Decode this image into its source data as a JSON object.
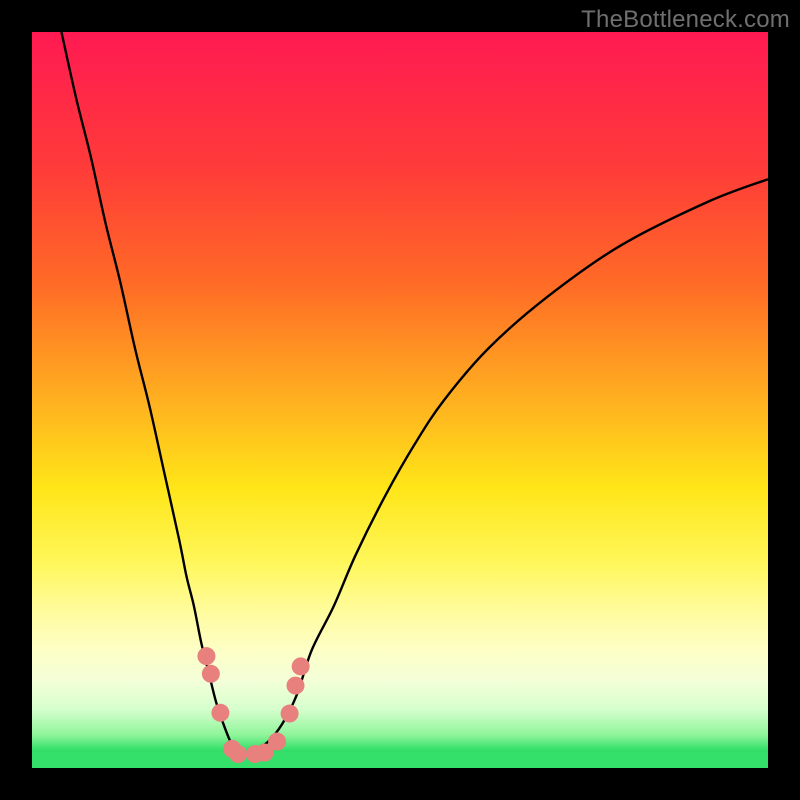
{
  "watermark": "TheBottleneck.com",
  "colors": {
    "curve_stroke": "#000000",
    "marker_fill": "#e8817e",
    "green_band": "#35e06a",
    "gradient_stops": [
      {
        "offset": 0.0,
        "color": "#ff1a52"
      },
      {
        "offset": 0.18,
        "color": "#ff3a3a"
      },
      {
        "offset": 0.34,
        "color": "#ff6a26"
      },
      {
        "offset": 0.5,
        "color": "#ffb020"
      },
      {
        "offset": 0.62,
        "color": "#ffe618"
      },
      {
        "offset": 0.72,
        "color": "#fff75a"
      },
      {
        "offset": 0.79,
        "color": "#fffca0"
      },
      {
        "offset": 0.84,
        "color": "#fdffc6"
      },
      {
        "offset": 0.88,
        "color": "#f4ffd8"
      },
      {
        "offset": 0.92,
        "color": "#d6ffce"
      },
      {
        "offset": 0.955,
        "color": "#8ff59a"
      },
      {
        "offset": 0.975,
        "color": "#35e06a"
      },
      {
        "offset": 1.0,
        "color": "#17c95c"
      }
    ]
  },
  "chart_data": {
    "type": "line",
    "title": "",
    "xlabel": "",
    "ylabel": "",
    "xlim": [
      0,
      100
    ],
    "ylim": [
      0,
      100
    ],
    "series": [
      {
        "name": "left-branch",
        "x": [
          4,
          6,
          8,
          10,
          12,
          14,
          16,
          18,
          20,
          21,
          22,
          23,
          24,
          25,
          26,
          27,
          28
        ],
        "y": [
          100,
          91,
          83,
          74,
          66,
          57,
          49,
          40,
          31,
          26,
          22,
          17,
          13,
          9,
          6,
          3.5,
          2
        ]
      },
      {
        "name": "right-branch",
        "x": [
          28,
          30,
          32,
          34,
          36,
          38,
          41,
          44,
          48,
          52,
          56,
          62,
          70,
          80,
          92,
          100
        ],
        "y": [
          2,
          2.4,
          3.5,
          6,
          10,
          16,
          22,
          29,
          37,
          44,
          50,
          57,
          64,
          71,
          77,
          80
        ]
      }
    ],
    "markers": {
      "name": "salmon-dots",
      "points": [
        {
          "x": 23.7,
          "y": 15.2
        },
        {
          "x": 24.3,
          "y": 12.8
        },
        {
          "x": 25.6,
          "y": 7.5
        },
        {
          "x": 27.2,
          "y": 2.6
        },
        {
          "x": 28.0,
          "y": 1.9
        },
        {
          "x": 30.3,
          "y": 1.9
        },
        {
          "x": 31.6,
          "y": 2.1
        },
        {
          "x": 33.3,
          "y": 3.6
        },
        {
          "x": 35.0,
          "y": 7.4
        },
        {
          "x": 35.8,
          "y": 11.2
        },
        {
          "x": 36.5,
          "y": 13.8
        }
      ]
    }
  }
}
